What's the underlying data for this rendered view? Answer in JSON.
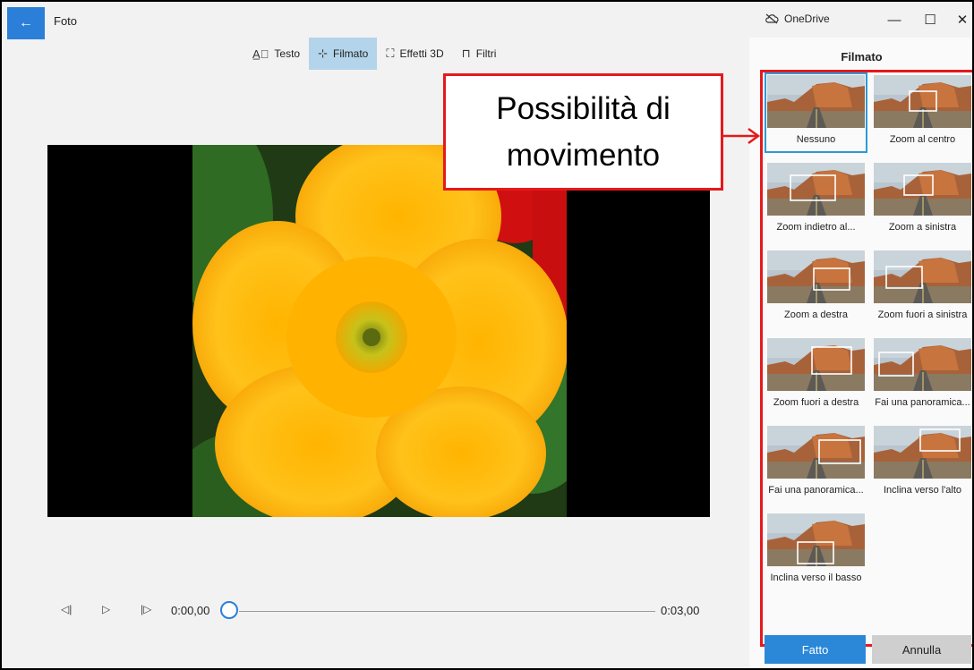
{
  "titlebar": {
    "back_icon": "back-arrow-icon",
    "app_title": "Foto",
    "onedrive_label": "OneDrive",
    "minimize": "—",
    "maximize": "☐",
    "close": "✕"
  },
  "toolbar": {
    "items": [
      {
        "icon": "text-icon",
        "label": "Testo",
        "active": false
      },
      {
        "icon": "motion-icon",
        "label": "Filmato",
        "active": true
      },
      {
        "icon": "3d-effects-icon",
        "label": "Effetti 3D",
        "active": false
      },
      {
        "icon": "filter-icon",
        "label": "Filtri",
        "active": false
      }
    ]
  },
  "playback": {
    "current_time": "0:00,00",
    "end_time": "0:03,00",
    "progress": 0
  },
  "panel": {
    "title": "Filmato",
    "options": [
      {
        "label": "Nessuno",
        "selected": true
      },
      {
        "label": "Zoom al centro"
      },
      {
        "label": "Zoom indietro al..."
      },
      {
        "label": "Zoom a sinistra"
      },
      {
        "label": "Zoom a destra"
      },
      {
        "label": "Zoom fuori a sinistra"
      },
      {
        "label": "Zoom fuori a destra"
      },
      {
        "label": "Fai una panoramica..."
      },
      {
        "label": "Fai una panoramica..."
      },
      {
        "label": "Inclina verso l'alto"
      },
      {
        "label": "Inclina verso il basso"
      }
    ],
    "done_label": "Fatto",
    "cancel_label": "Annulla"
  },
  "callout": {
    "line1": "Possibilità di",
    "line2": "movimento"
  },
  "colors": {
    "accent": "#2b88d8",
    "callout_red": "#e5191c",
    "selected_toolbar": "#b3d4ea"
  }
}
